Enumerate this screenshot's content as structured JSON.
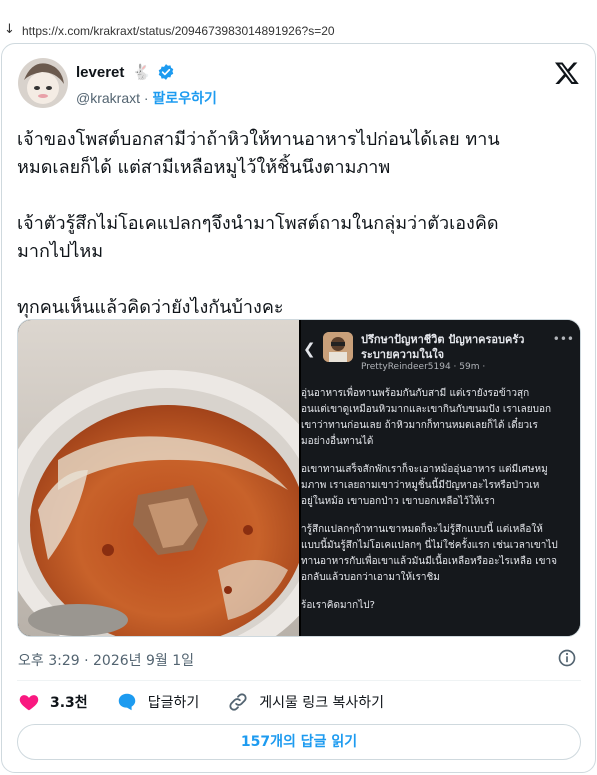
{
  "browser": {
    "url": "https://x.com/krakraxt/status/2094673983014891926?s=20"
  },
  "author": {
    "display_name": "leveret",
    "name_emoji": "🐇",
    "handle": "@krakraxt",
    "separator": "·",
    "follow_label": "팔로우하기"
  },
  "tweet": {
    "paragraphs": [
      [
        "เจ้าของโพสต์บอกสามีว่าถ้าหิวให้ทานอาหารไปก่อนได้เลย ทาน",
        "หมดเลยก็ได้ แต่สามีเหลือหมูไว้ให้ชิ้นนึงตามภาพ"
      ],
      [
        "เจ้าตัวรู้สึกไม่โอเคแปลกๆจึงนำมาโพสต์ถามในกลุ่มว่าตัวเองคิด",
        "มากไปไหม"
      ],
      [
        "ทุกคนเห็นแล้วคิดว่ายังไงกันบ้างคะ"
      ]
    ],
    "timestamp": "오후 3:29 · 2026년 9월 1일"
  },
  "screenshot_post": {
    "group_title": [
      "ปรึกษาปัญหาชีวิต ปัญหาครอบครัว",
      "ระบายความในใจ"
    ],
    "user": "PrettyReindeer5194 · 59m ·",
    "body_lines": [
      [
        "อุ่นอาหารเพื่อทานพร้อมกันกับสามี แต่เรายังรอข้าวสุก",
        "อนแต่เขาดูเหมือนหิวมากและเขากินกับขนมปัง เราเลยบอก",
        "เขาว่าทานก่อนเลย ถ้าหิวมากก็ทานหมดเลยก็ได้ เดี๋ยวเร",
        "มอย่างอื่นทานได้"
      ],
      [
        "อเขาทานเสร็จสักพักเราก็จะเอาหม้ออุ่นอาหาร แต่มีเศษหมู",
        "มภาพ เราเลยถามเขาว่าหมูชิ้นนี้มีปัญหาอะไรหรือป่าวเห",
        "อยู่ในหม้อ เขาบอกป่าว เขาบอกเหลือไว้ให้เรา"
      ],
      [
        "ารู้สึกแปลกๆถ้าทานเขาหมดก็จะไม่รู้สึกแบบนี้ แต่เหลือให้",
        "แบบนี้มันรู้สึกไม่โอเคแปลกๆ นี่ไม่ใช่ครั้งแรก เช่นเวลาเขาไป",
        "ทานอาหารกับเพื่อเขาแล้วมันมีเนื้อเหลือหรืออะไรเหลือ เขาจ",
        "อกลับแล้วบอกว่าเอามาให้เราชิม"
      ],
      [
        "ร้อเราคิดมากไป?"
      ]
    ]
  },
  "engagement": {
    "likes": "3.3천",
    "reply_label": "답글하기",
    "share_label": "게시물 링크 복사하기",
    "read_replies": "157개의 답글 읽기"
  },
  "colors": {
    "accent": "#1d9bf0",
    "like": "#f91880",
    "verified": "#1d9bf0",
    "text_secondary": "#536471"
  },
  "icons": {
    "verified": "verified-badge-icon",
    "x_logo": "x-logo-icon",
    "info": "info-icon",
    "like": "heart-icon",
    "reply": "reply-bubble-icon",
    "share": "link-icon"
  }
}
